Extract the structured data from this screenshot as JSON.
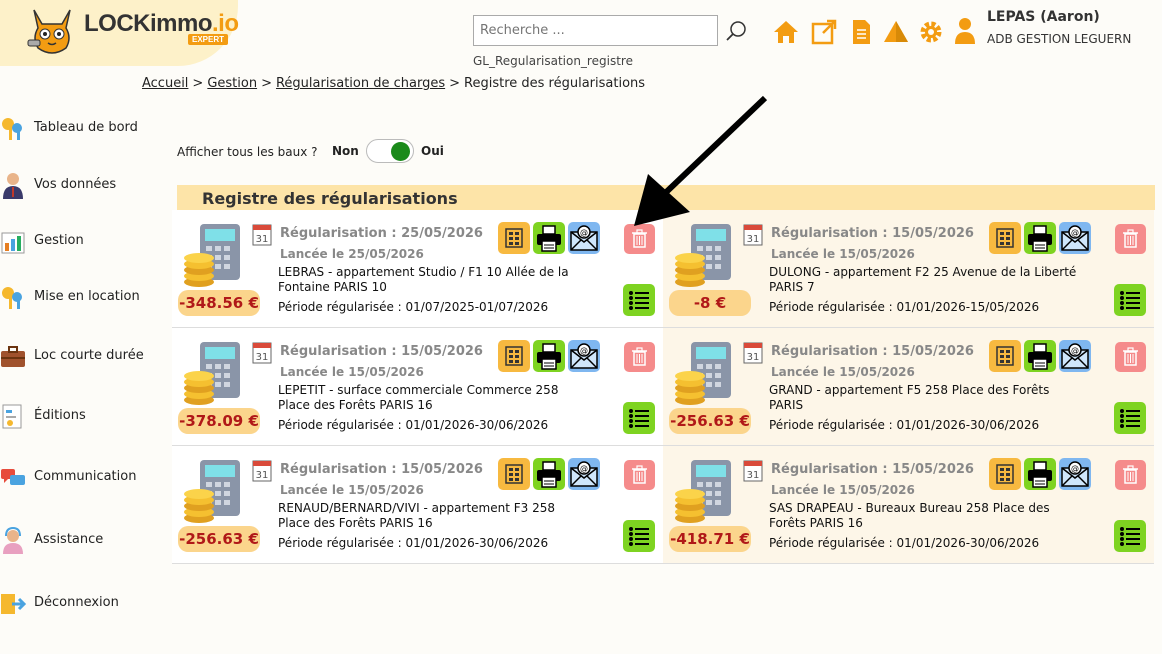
{
  "header": {
    "logo_text": "LOCKimmo",
    "logo_suffix": ".io",
    "logo_badge": "EXPERT",
    "search_placeholder": "Recherche ...",
    "search_caption": "GL_Regularisation_registre",
    "user_name": "LEPAS (Aaron)",
    "user_company": "ADB GESTION LEGUERN"
  },
  "breadcrumb": {
    "items": [
      "Accueil",
      "Gestion",
      "Régularisation de charges"
    ],
    "current": "Registre des régularisations",
    "separator": ">"
  },
  "sidebar": {
    "items": [
      {
        "label": "Tableau de bord"
      },
      {
        "label": "Vos données"
      },
      {
        "label": "Gestion"
      },
      {
        "label": "Mise en location"
      },
      {
        "label": "Loc courte durée"
      },
      {
        "label": "Éditions"
      },
      {
        "label": "Communication"
      },
      {
        "label": "Assistance"
      },
      {
        "label": "Déconnexion"
      }
    ]
  },
  "toggle": {
    "label": "Afficher tous les baux ?",
    "off_label": "Non",
    "on_label": "Oui",
    "state": "on"
  },
  "section": {
    "title": "Registre des régularisations"
  },
  "calendar_day": "31",
  "cards": [
    {
      "amount": "-348.56 €",
      "title": "Régularisation : 25/05/2026",
      "launch": "Lancée le 25/05/2026",
      "desc": "LEBRAS - appartement Studio / F1 10 Allée de la Fontaine PARIS 10",
      "periode": "Période régularisée : 01/07/2025-01/07/2026"
    },
    {
      "amount": "-8 €",
      "title": "Régularisation : 15/05/2026",
      "launch": "Lancée le 15/05/2026",
      "desc": "DULONG - appartement F2 25 Avenue de la Liberté PARIS 7",
      "periode": "Période régularisée : 01/01/2026-15/05/2026"
    },
    {
      "amount": "-378.09 €",
      "title": "Régularisation : 15/05/2026",
      "launch": "Lancée le 15/05/2026",
      "desc": "LEPETIT - surface commerciale Commerce 258 Place des Forêts PARIS 16",
      "periode": "Période régularisée : 01/01/2026-30/06/2026"
    },
    {
      "amount": "-256.63 €",
      "title": "Régularisation : 15/05/2026",
      "launch": "Lancée le 15/05/2026",
      "desc": "GRAND - appartement F5 258 Place des Forêts PARIS",
      "periode": "Période régularisée : 01/01/2026-30/06/2026"
    },
    {
      "amount": "-256.63 €",
      "title": "Régularisation : 15/05/2026",
      "launch": "Lancée le 15/05/2026",
      "desc": "RENAUD/BERNARD/VIVI - appartement F3 258 Place des Forêts PARIS 16",
      "periode": "Période régularisée : 01/01/2026-30/06/2026"
    },
    {
      "amount": "-418.71 €",
      "title": "Régularisation : 15/05/2026",
      "launch": "Lancée le 15/05/2026",
      "desc": "SAS DRAPEAU - Bureaux Bureau 258 Place des Forêts PARIS 16",
      "periode": "Période régularisée : 01/01/2026-30/06/2026"
    }
  ],
  "colors": {
    "accent": "#f39c12",
    "amount_bg": "#fbd58c",
    "amount_text": "#b01818",
    "section_bg": "#fde4a8",
    "toggle_on": "#1a8a1a"
  }
}
